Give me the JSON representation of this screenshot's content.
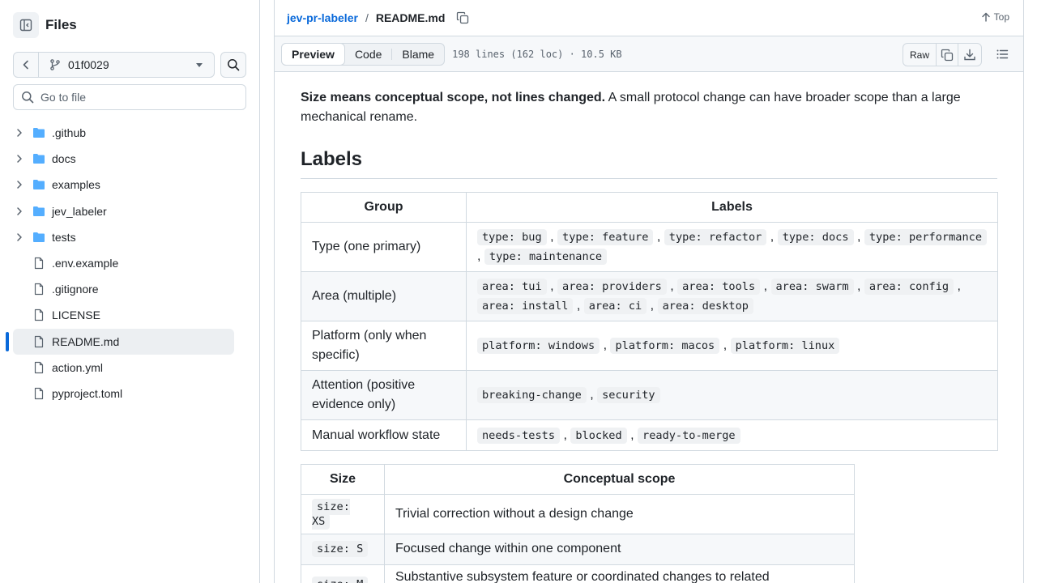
{
  "sidebar": {
    "title": "Files",
    "branch": "01f0029",
    "search_placeholder": "Go to file",
    "items": [
      {
        "label": ".github",
        "kind": "dir"
      },
      {
        "label": "docs",
        "kind": "dir"
      },
      {
        "label": "examples",
        "kind": "dir"
      },
      {
        "label": "jev_labeler",
        "kind": "dir"
      },
      {
        "label": "tests",
        "kind": "dir"
      },
      {
        "label": ".env.example",
        "kind": "file"
      },
      {
        "label": ".gitignore",
        "kind": "file"
      },
      {
        "label": "LICENSE",
        "kind": "file"
      },
      {
        "label": "README.md",
        "kind": "file",
        "active": true
      },
      {
        "label": "action.yml",
        "kind": "file"
      },
      {
        "label": "pyproject.toml",
        "kind": "file"
      }
    ]
  },
  "breadcrumb": {
    "repo": "jev-pr-labeler",
    "sep": "/",
    "file": "README.md"
  },
  "top_link": "Top",
  "fileheader": {
    "tabs": [
      "Preview",
      "Code",
      "Blame"
    ],
    "info": "198 lines (162 loc) · 10.5 KB",
    "raw": "Raw"
  },
  "content": {
    "intro_bold": "Size means conceptual scope, not lines changed.",
    "intro_rest": " A small protocol change can have broader scope than a large mechanical rename.",
    "heading": "Labels",
    "labels_table": {
      "headers": [
        "Group",
        "Labels"
      ],
      "rows": [
        {
          "group": "Type (one primary)",
          "labels": [
            "type: bug",
            "type: feature",
            "type: refactor",
            "type: docs",
            "type: performance",
            "type: maintenance"
          ]
        },
        {
          "group": "Area (multiple)",
          "labels": [
            "area: tui",
            "area: providers",
            "area: tools",
            "area: swarm",
            "area: config",
            "area: install",
            "area: ci",
            "area: desktop"
          ]
        },
        {
          "group": "Platform (only when specific)",
          "labels": [
            "platform: windows",
            "platform: macos",
            "platform: linux"
          ]
        },
        {
          "group": "Attention (positive evidence only)",
          "labels": [
            "breaking-change",
            "security"
          ]
        },
        {
          "group": "Manual workflow state",
          "labels": [
            "needs-tests",
            "blocked",
            "ready-to-merge"
          ]
        }
      ]
    },
    "size_table": {
      "headers": [
        "Size",
        "Conceptual scope"
      ],
      "rows": [
        {
          "size": "size: XS",
          "scope": "Trivial correction without a design change"
        },
        {
          "size": "size: S",
          "scope": "Focused change within one component"
        },
        {
          "size": "size: M",
          "scope": "Substantive subsystem feature or coordinated changes to related components"
        }
      ]
    }
  },
  "colors": {
    "accent": "#0969da",
    "folder": "#54aeff",
    "border": "#d1d9e0",
    "muted": "#59636e"
  }
}
